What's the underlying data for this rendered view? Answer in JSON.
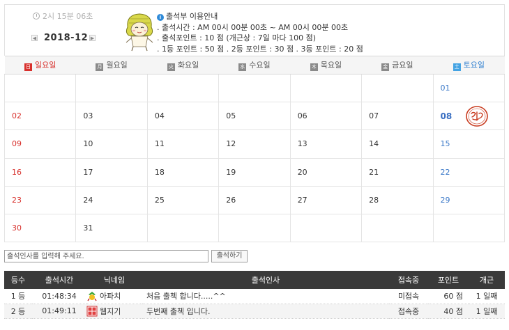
{
  "header": {
    "timer": "2시 15분 06초",
    "month": "2018-12",
    "prev_arrow": "◀",
    "next_arrow": "▶"
  },
  "notice": {
    "title": "출석부 이용안내",
    "time": ". 출석시간 : AM 00시 00분 00초 ~ AM 00시 00분 00초",
    "points": ". 출석포인트 : 10 점  (개근상 : 7일 마다 100 점)",
    "rank_points": ". 1등 포인트 : 50 점   . 2등 포인트 : 30 점   . 3등 포인트 : 20 점"
  },
  "calendar": {
    "weekdays": [
      {
        "badge": "日",
        "label": "일요일"
      },
      {
        "badge": "月",
        "label": "월요일"
      },
      {
        "badge": "火",
        "label": "화요일"
      },
      {
        "badge": "水",
        "label": "수요일"
      },
      {
        "badge": "木",
        "label": "목요일"
      },
      {
        "badge": "金",
        "label": "금요일"
      },
      {
        "badge": "土",
        "label": "토요일"
      }
    ],
    "weeks": [
      [
        "",
        "",
        "",
        "",
        "",
        "",
        "01"
      ],
      [
        "02",
        "03",
        "04",
        "05",
        "06",
        "07",
        "08"
      ],
      [
        "09",
        "10",
        "11",
        "12",
        "13",
        "14",
        "15"
      ],
      [
        "16",
        "17",
        "18",
        "19",
        "20",
        "21",
        "22"
      ],
      [
        "23",
        "24",
        "25",
        "26",
        "27",
        "28",
        "29"
      ],
      [
        "30",
        "31",
        "",
        "",
        "",
        "",
        ""
      ]
    ],
    "today": "08"
  },
  "greeting": {
    "placeholder": "출석인사를 입력해 주세요.",
    "button": "출석하기"
  },
  "attendance": {
    "headers": [
      "등수",
      "출석시간",
      "닉네임",
      "출석인사",
      "접속중",
      "포인트",
      "개근"
    ],
    "rows": [
      {
        "rank": "1 등",
        "time": "01:48:34",
        "nick": "아파치",
        "message": "처음 출첵 합니다.....^^",
        "online": "미접속",
        "points": "60 점",
        "streak": "1 일째"
      },
      {
        "rank": "2 등",
        "time": "01:49:11",
        "nick": "웹지기",
        "message": "두번째 출첵 입니다.",
        "online": "접속중",
        "points": "40 점",
        "streak": "1 일째"
      }
    ]
  },
  "colors": {
    "sunday": "#d8302c",
    "saturday": "#3a78c8",
    "header_bg": "#3a3a3a",
    "info": "#2e8ad8"
  },
  "icons": {
    "timer": "clock-icon",
    "notice": "info-icon",
    "mascot": "mascot-illustration",
    "stamp": "attendance-stamp-icon"
  }
}
